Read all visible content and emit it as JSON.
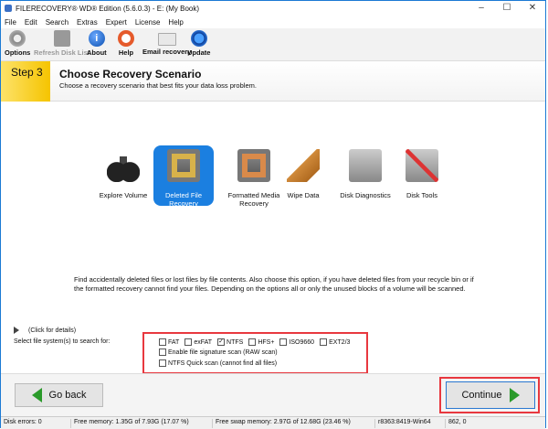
{
  "window": {
    "title": "FILERECOVERY® WD® Edition (5.6.0.3) - E: (My Book)"
  },
  "menu": [
    "File",
    "Edit",
    "Search",
    "Extras",
    "Expert",
    "License",
    "Help"
  ],
  "toolbar": [
    {
      "label": "Options",
      "icon": "gear-icon",
      "enabled": true
    },
    {
      "label": "Refresh Disk List",
      "icon": "disk-icon",
      "enabled": false
    },
    {
      "label": "About",
      "icon": "info-icon",
      "enabled": true
    },
    {
      "label": "Help",
      "icon": "lifebuoy-icon",
      "enabled": true
    },
    {
      "label": "Email recovery",
      "icon": "envelope-icon",
      "enabled": true
    },
    {
      "label": "Update",
      "icon": "update-icon",
      "enabled": true
    }
  ],
  "step": {
    "number": "Step 3",
    "title": "Choose Recovery Scenario",
    "subtitle": "Choose a recovery scenario that best fits your data loss problem."
  },
  "scenarios": [
    {
      "label": "Explore Volume",
      "icon": "binoculars-icon",
      "selected": false
    },
    {
      "label": "Deleted File Recovery",
      "icon": "deleted-file-drive-icon",
      "selected": true
    },
    {
      "label": "Formatted Media Recovery",
      "icon": "formatted-drive-icon",
      "selected": false
    },
    {
      "label": "Wipe Data",
      "icon": "broom-icon",
      "selected": false
    },
    {
      "label": "Disk Diagnostics",
      "icon": "diagnostics-drive-icon",
      "selected": false
    },
    {
      "label": "Disk Tools",
      "icon": "tools-drive-icon",
      "selected": false
    }
  ],
  "description": "Find accidentally deleted files or lost files by file contents. Also choose this option, if you have deleted files from your recycle bin or if the formatted recovery cannot find your files. Depending on the options all or only the unused blocks of a volume will be scanned.",
  "details_label": "(Click for details)",
  "fs_label": "Select file system(s) to search for:",
  "filesystems": [
    {
      "label": "FAT",
      "checked": false
    },
    {
      "label": "exFAT",
      "checked": false
    },
    {
      "label": "NTFS",
      "checked": true
    },
    {
      "label": "HFS+",
      "checked": false
    },
    {
      "label": "ISO9660",
      "checked": false
    },
    {
      "label": "EXT2/3",
      "checked": false
    }
  ],
  "options": [
    {
      "label": "Enable file signature scan (RAW scan)",
      "checked": false
    },
    {
      "label": "NTFS Quick scan (cannot find all files)",
      "checked": false
    }
  ],
  "buttons": {
    "back": "Go back",
    "continue": "Continue"
  },
  "status": [
    "Disk errors: 0",
    "Free memory: 1.35G of 7.93G (17.07 %)",
    "Free swap memory: 2.97G of 12.68G (23.46 %)",
    "r8363:8419-Win64",
    "862, 0"
  ]
}
